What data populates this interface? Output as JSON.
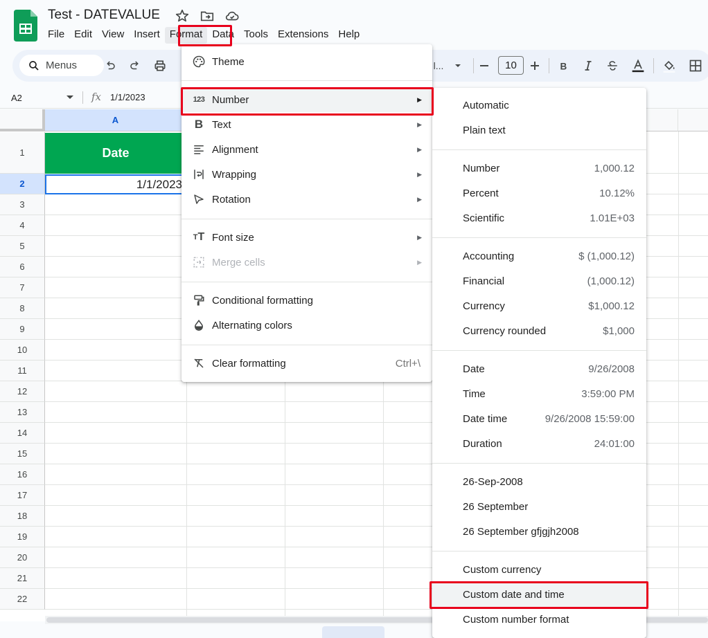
{
  "app": {
    "title": "Test - DATEVALUE",
    "menus": [
      "File",
      "Edit",
      "View",
      "Insert",
      "Format",
      "Data",
      "Tools",
      "Extensions",
      "Help"
    ],
    "active_menu": "Format"
  },
  "toolbar": {
    "search_label": "Menus",
    "font_truncated": "l...",
    "font_size": "10"
  },
  "formula_bar": {
    "cell_ref": "A2",
    "fx": "fx",
    "value": "1/1/2023"
  },
  "grid": {
    "columns": [
      "A"
    ],
    "rows": [
      "1",
      "2",
      "3",
      "4",
      "5",
      "6",
      "7",
      "8",
      "9",
      "10",
      "11",
      "12",
      "13",
      "14",
      "15",
      "16",
      "17",
      "18",
      "19",
      "20",
      "21",
      "22"
    ],
    "header_cell": "Date",
    "value_cell": "1/1/2023"
  },
  "format_menu": {
    "items": [
      {
        "label": "Theme",
        "icon": "palette-icon"
      },
      {
        "label": "Number",
        "icon": "number-123-icon",
        "submenu": true
      },
      {
        "label": "Text",
        "icon": "bold-b-icon",
        "submenu": true
      },
      {
        "label": "Alignment",
        "icon": "align-left-icon",
        "submenu": true
      },
      {
        "label": "Wrapping",
        "icon": "wrap-icon",
        "submenu": true
      },
      {
        "label": "Rotation",
        "icon": "rotation-icon",
        "submenu": true
      },
      {
        "label": "Font size",
        "icon": "font-size-icon",
        "submenu": true
      },
      {
        "label": "Merge cells",
        "icon": "merge-cells-icon",
        "submenu": true,
        "disabled": true
      },
      {
        "label": "Conditional formatting",
        "icon": "paint-roller-icon"
      },
      {
        "label": "Alternating colors",
        "icon": "droplet-icon"
      },
      {
        "label": "Clear formatting",
        "icon": "clear-format-icon",
        "shortcut": "Ctrl+\\"
      }
    ]
  },
  "number_submenu": {
    "items": [
      {
        "label": "Automatic",
        "example": ""
      },
      {
        "label": "Plain text",
        "example": ""
      },
      {
        "label": "Number",
        "example": "1,000.12"
      },
      {
        "label": "Percent",
        "example": "10.12%"
      },
      {
        "label": "Scientific",
        "example": "1.01E+03"
      },
      {
        "label": "Accounting",
        "example": "$ (1,000.12)"
      },
      {
        "label": "Financial",
        "example": "(1,000.12)"
      },
      {
        "label": "Currency",
        "example": "$1,000.12"
      },
      {
        "label": "Currency rounded",
        "example": "$1,000"
      },
      {
        "label": "Date",
        "example": "9/26/2008"
      },
      {
        "label": "Time",
        "example": "3:59:00 PM"
      },
      {
        "label": "Date time",
        "example": "9/26/2008 15:59:00"
      },
      {
        "label": "Duration",
        "example": "24:01:00"
      },
      {
        "label": "26-Sep-2008",
        "example": ""
      },
      {
        "label": "26 September",
        "example": ""
      },
      {
        "label": "26 September gfjgjh2008",
        "example": ""
      },
      {
        "label": "Custom currency",
        "example": ""
      },
      {
        "label": "Custom date and time",
        "example": ""
      },
      {
        "label": "Custom number format",
        "example": ""
      }
    ]
  },
  "colors": {
    "highlight_box": "#e8001c",
    "header_fill": "#00a651",
    "selection": "#1a73e8"
  }
}
